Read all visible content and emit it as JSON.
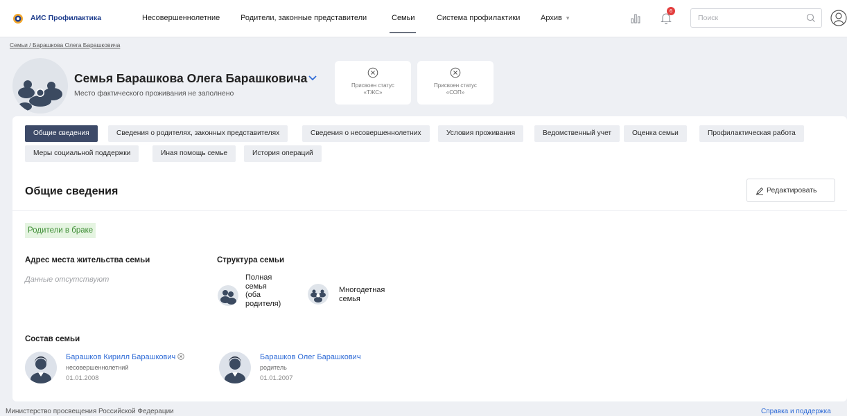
{
  "app": {
    "logo_text": "АИС Профилактика"
  },
  "nav": {
    "items": [
      {
        "label": "Несовершеннолетние"
      },
      {
        "label": "Родители, законные представители"
      },
      {
        "label": "Семьи"
      },
      {
        "label": "Система профилактики"
      },
      {
        "label": "Архив"
      }
    ],
    "active_index": 2,
    "notification_count": "6",
    "search_placeholder": "Поиск"
  },
  "breadcrumb": "Семьи / Барашкова Олега Барашковича",
  "header": {
    "title": "Семья Барашкова Олега Барашковича",
    "address_note": "Место фактического проживания не заполнено",
    "status_cards": [
      {
        "label": "Присвоен статус «ТЖС»"
      },
      {
        "label": "Присвоен статус «СОП»"
      }
    ]
  },
  "tabs": [
    {
      "label": "Общие сведения"
    },
    {
      "label": "Сведения о родителях, законных представителях"
    },
    {
      "label": "Сведения о несовершеннолетних"
    },
    {
      "label": "Условия проживания"
    },
    {
      "label": "Ведомственный учет"
    },
    {
      "label": "Оценка семьи"
    },
    {
      "label": "Профилактическая работа"
    },
    {
      "label": "Меры социальной поддержки"
    },
    {
      "label": "Иная помощь семье"
    },
    {
      "label": "История операций"
    }
  ],
  "active_tab": 0,
  "section": {
    "title": "Общие сведения",
    "edit_label": "Редактировать",
    "marriage_badge": "Родители в браке",
    "address_label": "Адрес места жительства семьи",
    "address_value": "Данные отсутствуют",
    "structure_label": "Структура семьи",
    "structure_items": [
      {
        "lines": [
          "Полная",
          "семья",
          "(оба",
          "родителя)"
        ]
      },
      {
        "lines": [
          "Многодетная",
          "семья"
        ]
      }
    ],
    "members_label": "Состав семьи",
    "members": [
      {
        "name": "Барашков Кирилл Барашкович",
        "role": "несовершеннолетний",
        "date": "01.01.2008"
      },
      {
        "name": "Барашков Олег Барашкович",
        "role": "родитель",
        "date": "01.01.2007"
      }
    ]
  },
  "footer": {
    "left": "Министерство просвещения Российской Федерации",
    "right": "Справка и поддержка"
  },
  "colors": {
    "primary_dark": "#3d4a68",
    "link": "#2f6bd6",
    "badge_green_bg": "#e5f4e1",
    "badge_green_text": "#3d8d34",
    "notification": "#e33d3d"
  }
}
